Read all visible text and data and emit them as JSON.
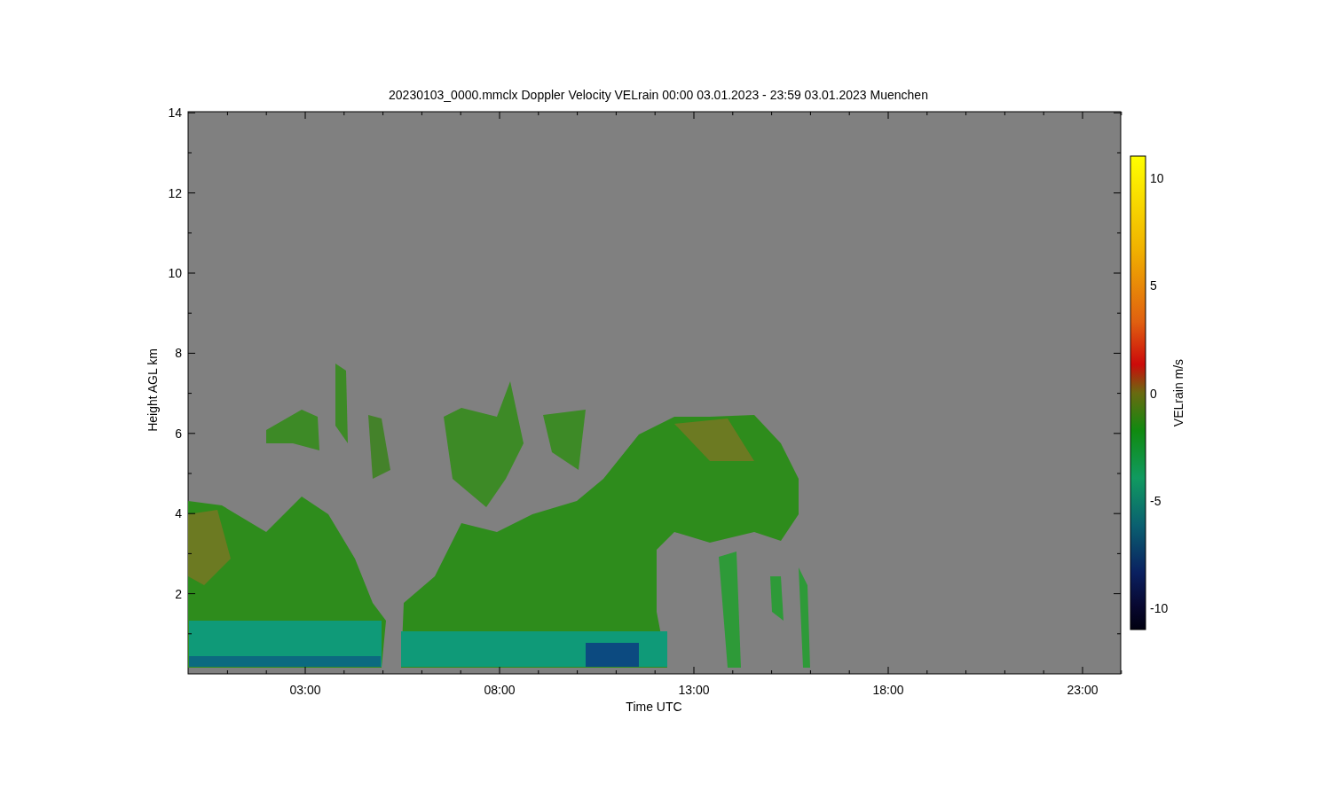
{
  "title": "20230103_0000.mmclx Doppler Velocity VELrain   00:00 03.01.2023 - 23:59 03.01.2023 Muenchen",
  "y_axis": {
    "label": "Height AGL km",
    "ticks": [
      "14",
      "12",
      "10",
      "8",
      "6",
      "4",
      "2"
    ]
  },
  "x_axis": {
    "label": "Time UTC",
    "ticks": [
      "03:00",
      "08:00",
      "13:00",
      "18:00",
      "23:00"
    ]
  },
  "colorbar": {
    "label": "VELrain m/s",
    "ticks": [
      "10",
      "5",
      "0",
      "-5",
      "-10"
    ]
  }
}
